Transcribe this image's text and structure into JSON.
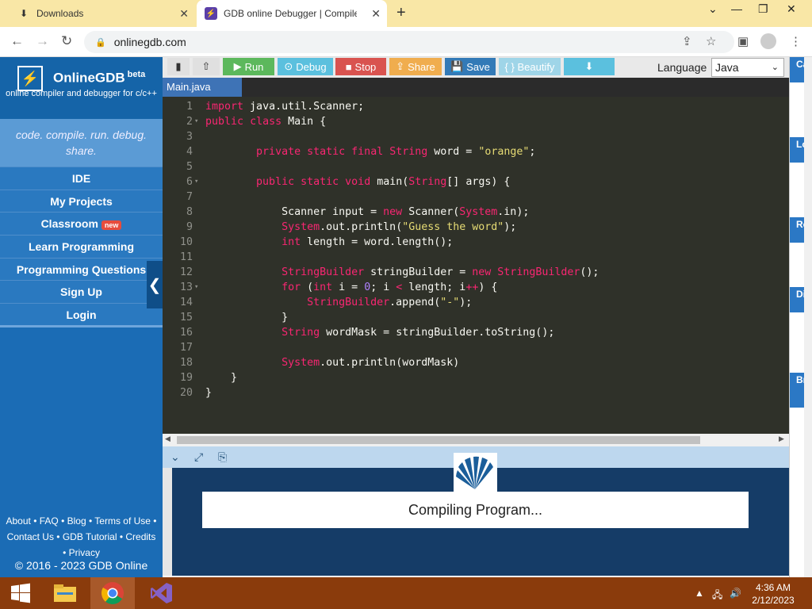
{
  "browser": {
    "tabs": [
      {
        "label": "Downloads",
        "icon": "download-icon"
      },
      {
        "label": "GDB online Debugger | Compiler",
        "icon": "onlinegdb-favicon"
      }
    ],
    "url": "onlinegdb.com"
  },
  "sidebar": {
    "brand": "OnlineGDB",
    "beta": "beta",
    "subtitle": "online compiler and debugger for c/c++",
    "tagline": "code. compile. run. debug. share.",
    "nav": [
      "IDE",
      "My Projects",
      "Classroom",
      "Learn Programming",
      "Programming Questions",
      "Sign Up",
      "Login"
    ],
    "new_badge": "new",
    "footer_line1": "About • FAQ • Blog • Terms of Use •",
    "footer_line2": "Contact Us • GDB Tutorial • Credits",
    "footer_line3": "• Privacy",
    "copyright": "© 2016 - 2023 GDB Online"
  },
  "toolbar": {
    "run": "Run",
    "debug": "Debug",
    "stop": "Stop",
    "share": "Share",
    "save": "Save",
    "beautify": "{ } Beautify",
    "language_label": "Language",
    "language_value": "Java",
    "colors": {
      "run": "#5cb85c",
      "debug": "#5bc0de",
      "stop": "#d9534f",
      "share": "#f0ad4e",
      "save": "#337ab7"
    }
  },
  "editor": {
    "file_tab": "Main.java",
    "line_numbers": [
      "1",
      "2",
      "3",
      "4",
      "5",
      "6",
      "7",
      "8",
      "9",
      "10",
      "11",
      "12",
      "13",
      "14",
      "15",
      "16",
      "17",
      "18",
      "19",
      "20"
    ]
  },
  "output": {
    "status": "Compiling Program..."
  },
  "right_panel": {
    "sections": [
      "Call Stack",
      "Local Variables",
      "Registers",
      "Display Expressions",
      "Breakpoints and Watchpoints"
    ]
  },
  "taskbar": {
    "time": "4:36 AM",
    "date": "2/12/2023"
  }
}
